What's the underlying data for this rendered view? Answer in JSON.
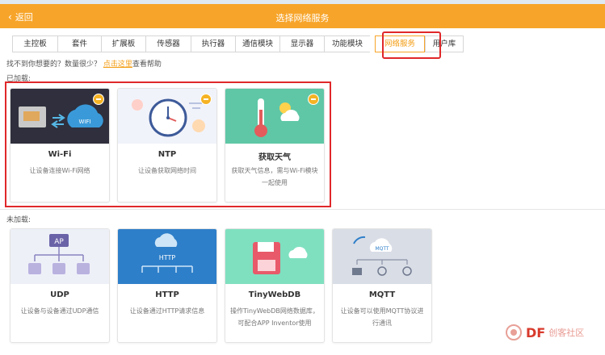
{
  "header": {
    "back_label": "返回",
    "title": "选择网络服务",
    "accent_color": "#f7a52a"
  },
  "tabs": [
    {
      "label": "主控板"
    },
    {
      "label": "套件"
    },
    {
      "label": "扩展板"
    },
    {
      "label": "传感器"
    },
    {
      "label": "执行器"
    },
    {
      "label": "通信模块"
    },
    {
      "label": "显示器"
    },
    {
      "label": "功能模块"
    },
    {
      "label": "网络服务",
      "active": true
    },
    {
      "label": "用户库"
    }
  ],
  "help": {
    "prefix": "找不到你想要的？数量很少？",
    "link": "点击这里",
    "suffix": "查看帮助"
  },
  "loaded": {
    "label": "已加载:",
    "items": [
      {
        "name": "Wi-Fi",
        "desc": "让设备连接Wi-Fi网络",
        "icon": "wifi-cloud-icon"
      },
      {
        "name": "NTP",
        "desc": "让设备获取网络时间",
        "icon": "clock-icon"
      },
      {
        "name": "获取天气",
        "desc": "获取天气信息，需与Wi-Fi模块一起使用",
        "icon": "weather-icon"
      }
    ]
  },
  "unloaded": {
    "label": "未加载:",
    "items": [
      {
        "name": "UDP",
        "desc": "让设备与设备通过UDP通信",
        "icon": "udp-ap-icon"
      },
      {
        "name": "HTTP",
        "desc": "让设备通过HTTP请求信息",
        "icon": "http-cloud-icon"
      },
      {
        "name": "TinyWebDB",
        "desc": "操作TinyWebDB网络数据库，可配合APP Inventor使用",
        "icon": "database-icon"
      },
      {
        "name": "MQTT",
        "desc": "让设备可以使用MQTT协议进行通讯",
        "icon": "mqtt-cloud-icon"
      }
    ]
  },
  "watermark": {
    "brand": "DF",
    "cn": "创客社区"
  }
}
